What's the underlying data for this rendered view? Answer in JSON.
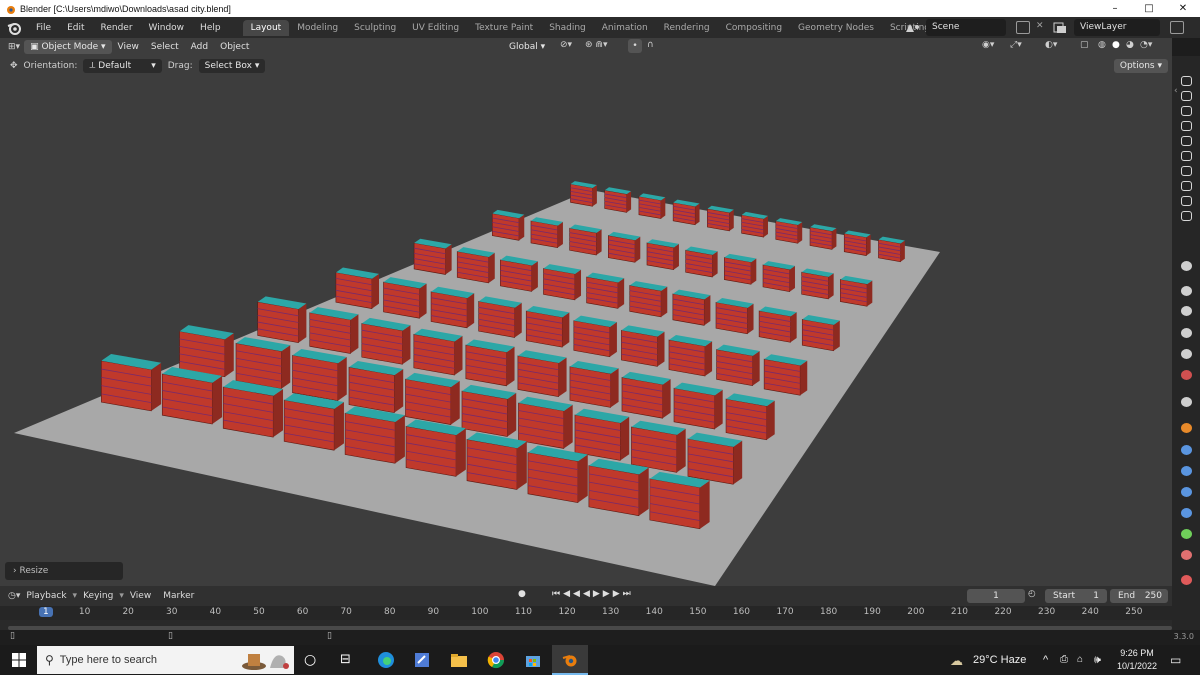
{
  "window": {
    "title": "Blender [C:\\Users\\mdiwo\\Downloads\\asad city.blend]",
    "controls": [
      "–",
      "□",
      "✕"
    ]
  },
  "menu": [
    "File",
    "Edit",
    "Render",
    "Window",
    "Help"
  ],
  "workspaces": {
    "active": "Layout",
    "tabs": [
      "Layout",
      "Modeling",
      "Sculpting",
      "UV Editing",
      "Texture Paint",
      "Shading",
      "Animation",
      "Rendering",
      "Compositing",
      "Geometry Nodes",
      "Scripting"
    ],
    "add": "+"
  },
  "scene": {
    "name": "Scene"
  },
  "view_layer": {
    "name": "ViewLayer"
  },
  "viewport_header": {
    "mode": "Object Mode",
    "menus": [
      "View",
      "Select",
      "Add",
      "Object"
    ],
    "transform_orientation": "Global"
  },
  "tool_settings": {
    "orientation_label": "Orientation:",
    "orientation_value": "Default",
    "drag_label": "Drag:",
    "drag_value": "Select Box",
    "options": "Options"
  },
  "operator_panel": {
    "label": "Resize"
  },
  "timeline": {
    "menus": [
      "Playback",
      "Keying",
      "View",
      "Marker"
    ],
    "current_frame": "1",
    "start_label": "Start",
    "start": "1",
    "end_label": "End",
    "end": "250",
    "ruler": [
      "1",
      "10",
      "20",
      "30",
      "40",
      "50",
      "60",
      "70",
      "80",
      "90",
      "100",
      "110",
      "120",
      "130",
      "140",
      "150",
      "160",
      "170",
      "180",
      "190",
      "200",
      "210",
      "220",
      "230",
      "240",
      "250"
    ]
  },
  "status": {
    "version": "3.3.0"
  },
  "taskbar": {
    "search_placeholder": "Type here to search",
    "weather": "29°C  Haze",
    "time": "9:26 PM",
    "date": "10/1/2022"
  },
  "colors": {
    "accent": "#4772b3",
    "building_wall": "#c0392b",
    "building_roof": "#2ca7a7",
    "ground": "#a8a8a8",
    "viewport_bg": "#3d3d3d"
  }
}
